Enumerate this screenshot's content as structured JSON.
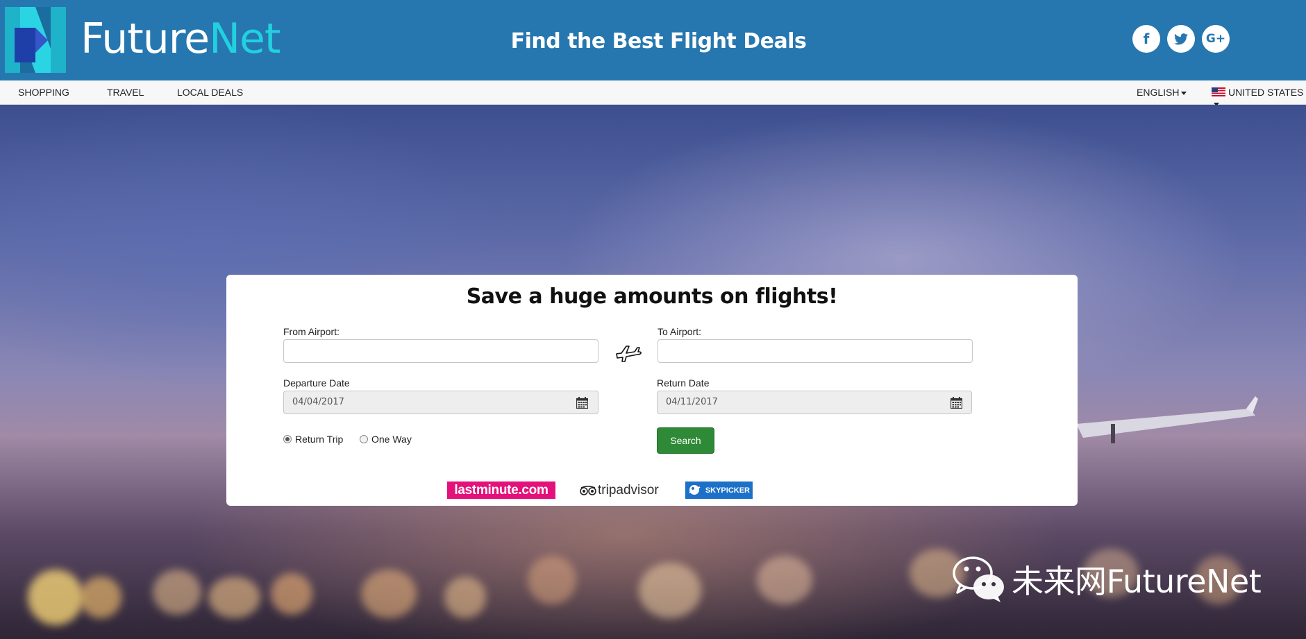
{
  "header": {
    "logo_part1": "Future",
    "logo_part2": "Net",
    "tagline": "Find the Best Flight Deals",
    "social": [
      {
        "name": "facebook",
        "glyph": "f"
      },
      {
        "name": "twitter",
        "glyph": "t"
      },
      {
        "name": "google-plus",
        "glyph": "G+"
      }
    ]
  },
  "nav": {
    "items": [
      "SHOPPING",
      "TRAVEL",
      "LOCAL DEALS"
    ],
    "language": "ENGLISH",
    "country": "UNITED STATES"
  },
  "search": {
    "title": "Save a huge amounts on flights!",
    "from_label": "From Airport:",
    "from_value": "",
    "to_label": "To Airport:",
    "to_value": "",
    "departure_label": "Departure Date",
    "departure_value": "04/04/2017",
    "return_label": "Return Date",
    "return_value": "04/11/2017",
    "trip_options": [
      {
        "label": "Return Trip",
        "selected": true
      },
      {
        "label": "One Way",
        "selected": false
      }
    ],
    "search_button": "Search"
  },
  "partners": {
    "lastminute": "lastminute.com",
    "tripadvisor": "tripadvisor",
    "skypicker": "SKYPICKER"
  },
  "watermark": {
    "text": "未来网FutureNet"
  },
  "colors": {
    "header_bg": "#2677b0",
    "logo_accent": "#22d0e0",
    "search_button": "#2e8a36",
    "lastminute": "#e5117b",
    "skypicker": "#1c70c8"
  }
}
